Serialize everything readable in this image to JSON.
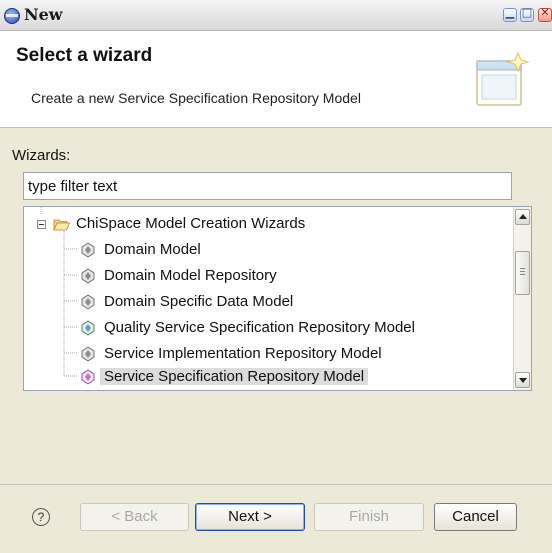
{
  "window": {
    "title": "New"
  },
  "banner": {
    "title": "Select a wizard",
    "description": "Create a new Service Specification Repository Model",
    "icon": "wizard-banner-icon"
  },
  "wizards": {
    "label": "Wizards:",
    "filter_value": "type filter text",
    "tree": {
      "category": {
        "label": "ChiSpace Model Creation Wizards",
        "expanded": true,
        "icon": "open-folder-icon"
      },
      "items": [
        {
          "label": "Domain Model",
          "icon": "model-wizard-icon",
          "selected": false
        },
        {
          "label": "Domain Model Repository",
          "icon": "model-wizard-icon",
          "selected": false
        },
        {
          "label": "Domain Specific Data Model",
          "icon": "model-wizard-icon",
          "selected": false
        },
        {
          "label": "Quality Service Specification Repository Model",
          "icon": "model-wizard-icon",
          "selected": false
        },
        {
          "label": "Service Implementation Repository Model",
          "icon": "model-wizard-icon",
          "selected": false
        },
        {
          "label": "Service Specification Repository Model",
          "icon": "model-wizard-icon",
          "selected": true
        }
      ]
    }
  },
  "footer": {
    "help_glyph": "?",
    "back_label": "< Back",
    "next_label": "Next >",
    "finish_label": "Finish",
    "cancel_label": "Cancel",
    "back_enabled": false,
    "finish_enabled": false
  },
  "colors": {
    "dialog_background": "#ece9d8",
    "selection_background": "#dcdcdc",
    "default_button_border": "#1d4fa8"
  }
}
